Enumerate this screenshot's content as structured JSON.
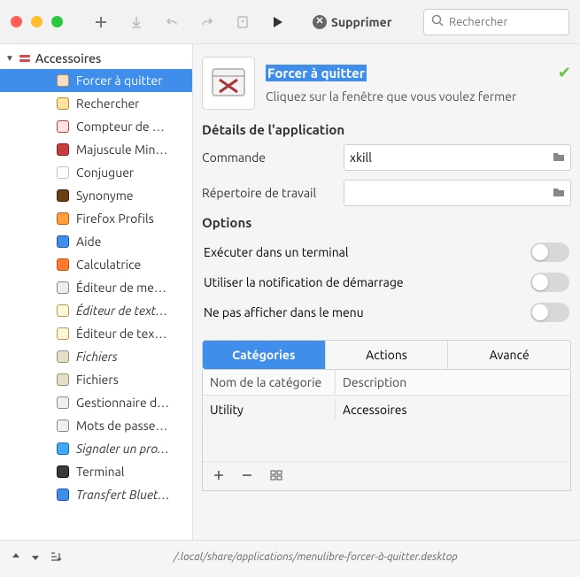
{
  "toolbar": {
    "delete_label": "Supprimer",
    "search_placeholder": "Rechercher"
  },
  "sidebar": {
    "header": "Accessoires",
    "items": [
      {
        "label": "Forcer à quitter",
        "selected": true,
        "italic": false,
        "icon_bg": "#f1dfc6",
        "icon_stroke": "#b08c5c"
      },
      {
        "label": "Rechercher",
        "selected": false,
        "italic": false,
        "icon_bg": "#ffe3a3",
        "icon_stroke": "#c58a1c"
      },
      {
        "label": "Compteur de …",
        "selected": false,
        "italic": false,
        "icon_bg": "#ffe3e0",
        "icon_stroke": "#b0473c"
      },
      {
        "label": "Majuscule Min…",
        "selected": false,
        "italic": false,
        "icon_bg": "#c73c3c",
        "icon_stroke": "#8d1f1f"
      },
      {
        "label": "Conjuguer",
        "selected": false,
        "italic": false,
        "icon_bg": "#ffffff",
        "icon_stroke": "#bdbdbd"
      },
      {
        "label": "Synonyme",
        "selected": false,
        "italic": false,
        "icon_bg": "#6b3e12",
        "icon_stroke": "#3e2307"
      },
      {
        "label": "Firefox Profils",
        "selected": false,
        "italic": false,
        "icon_bg": "#ff9e3b",
        "icon_stroke": "#c0571b"
      },
      {
        "label": "Aide",
        "selected": false,
        "italic": false,
        "icon_bg": "#3f8eeb",
        "icon_stroke": "#1c5ba8"
      },
      {
        "label": "Calculatrice",
        "selected": false,
        "italic": false,
        "icon_bg": "#ff7a2d",
        "icon_stroke": "#c74f10"
      },
      {
        "label": "Éditeur de me…",
        "selected": false,
        "italic": false,
        "icon_bg": "#eeeeee",
        "icon_stroke": "#888888"
      },
      {
        "label": "Éditeur de text…",
        "selected": false,
        "italic": true,
        "icon_bg": "#fff7d8",
        "icon_stroke": "#b59a4c"
      },
      {
        "label": "Éditeur de tex…",
        "selected": false,
        "italic": false,
        "icon_bg": "#fff7d8",
        "icon_stroke": "#b59a4c"
      },
      {
        "label": "Fichiers",
        "selected": false,
        "italic": true,
        "icon_bg": "#e5ddc9",
        "icon_stroke": "#9c8f6e"
      },
      {
        "label": "Fichiers",
        "selected": false,
        "italic": false,
        "icon_bg": "#e5ddc9",
        "icon_stroke": "#9c8f6e"
      },
      {
        "label": "Gestionnaire d…",
        "selected": false,
        "italic": false,
        "icon_bg": "#efefef",
        "icon_stroke": "#888888"
      },
      {
        "label": "Mots de passe…",
        "selected": false,
        "italic": false,
        "icon_bg": "#efefef",
        "icon_stroke": "#888888"
      },
      {
        "label": "Signaler un pro…",
        "selected": false,
        "italic": true,
        "icon_bg": "#3fa9f5",
        "icon_stroke": "#1e6aa8"
      },
      {
        "label": "Terminal",
        "selected": false,
        "italic": false,
        "icon_bg": "#3a3a3a",
        "icon_stroke": "#111111"
      },
      {
        "label": "Transfert Bluet…",
        "selected": false,
        "italic": true,
        "icon_bg": "#3f8eeb",
        "icon_stroke": "#1c5ba8"
      }
    ]
  },
  "details": {
    "app_name": "Forcer à quitter",
    "app_comment": "Cliquez sur la fenêtre que vous voulez fermer",
    "section_details": "Détails de l'application",
    "command_label": "Commande",
    "command_value": "xkill",
    "workdir_label": "Répertoire de travail",
    "workdir_value": "",
    "section_options": "Options",
    "opt_terminal": "Exécuter dans un terminal",
    "opt_notify": "Utiliser la notification de démarrage",
    "opt_hide": "Ne pas afficher dans le menu",
    "tabs": {
      "categories": "Catégories",
      "actions": "Actions",
      "advanced": "Avancé"
    },
    "cat_col_name": "Nom de la catégorie",
    "cat_col_desc": "Description",
    "cat_rows": [
      {
        "name": "Utility",
        "desc": "Accessoires"
      }
    ]
  },
  "footer": {
    "path": "/.local/share/applications/menulibre-forcer-à-quitter.desktop"
  }
}
